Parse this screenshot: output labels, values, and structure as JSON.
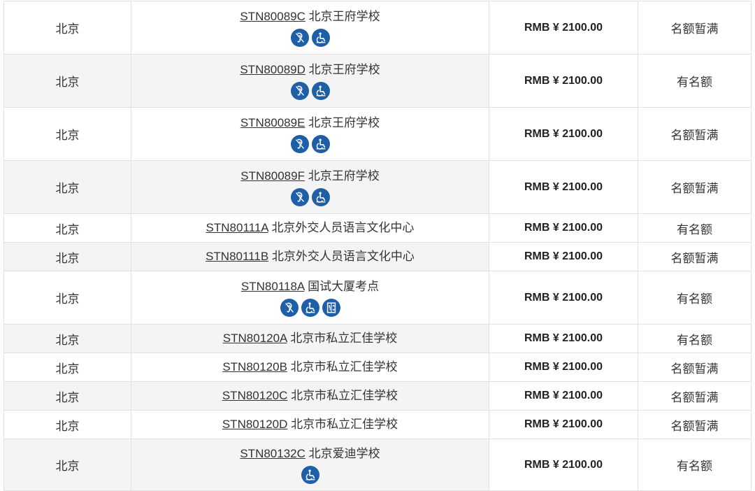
{
  "rows": [
    {
      "city": "北京",
      "code": "STN80089C",
      "name": "北京王府学校",
      "icons": [
        "hearing-icon",
        "wheelchair-icon"
      ],
      "price": "RMB ¥ 2100.00",
      "status": "名额暂满"
    },
    {
      "city": "北京",
      "code": "STN80089D",
      "name": "北京王府学校",
      "icons": [
        "hearing-icon",
        "wheelchair-icon"
      ],
      "price": "RMB ¥ 2100.00",
      "status": "有名额"
    },
    {
      "city": "北京",
      "code": "STN80089E",
      "name": "北京王府学校",
      "icons": [
        "hearing-icon",
        "wheelchair-icon"
      ],
      "price": "RMB ¥ 2100.00",
      "status": "名额暂满"
    },
    {
      "city": "北京",
      "code": "STN80089F",
      "name": "北京王府学校",
      "icons": [
        "hearing-icon",
        "wheelchair-icon"
      ],
      "price": "RMB ¥ 2100.00",
      "status": "名额暂满"
    },
    {
      "city": "北京",
      "code": "STN80111A",
      "name": "北京外交人员语言文化中心",
      "icons": [],
      "price": "RMB ¥ 2100.00",
      "status": "有名额"
    },
    {
      "city": "北京",
      "code": "STN80111B",
      "name": "北京外交人员语言文化中心",
      "icons": [],
      "price": "RMB ¥ 2100.00",
      "status": "名额暂满"
    },
    {
      "city": "北京",
      "code": "STN80118A",
      "name": "国试大厦考点",
      "icons": [
        "hearing-icon",
        "wheelchair-icon",
        "elevator-icon"
      ],
      "price": "RMB ¥ 2100.00",
      "status": "有名额"
    },
    {
      "city": "北京",
      "code": "STN80120A",
      "name": "北京市私立汇佳学校",
      "icons": [],
      "price": "RMB ¥ 2100.00",
      "status": "有名额"
    },
    {
      "city": "北京",
      "code": "STN80120B",
      "name": "北京市私立汇佳学校",
      "icons": [],
      "price": "RMB ¥ 2100.00",
      "status": "名额暂满"
    },
    {
      "city": "北京",
      "code": "STN80120C",
      "name": "北京市私立汇佳学校",
      "icons": [],
      "price": "RMB ¥ 2100.00",
      "status": "名额暂满"
    },
    {
      "city": "北京",
      "code": "STN80120D",
      "name": "北京市私立汇佳学校",
      "icons": [],
      "price": "RMB ¥ 2100.00",
      "status": "名额暂满"
    },
    {
      "city": "北京",
      "code": "STN80132C",
      "name": "北京爱迪学校",
      "icons": [
        "wheelchair-icon"
      ],
      "price": "RMB ¥ 2100.00",
      "status": "有名额"
    }
  ],
  "colors": {
    "icon_bg": "#1f5fa8",
    "border": "#e1e1e1",
    "zebra": "#f4f4f4"
  }
}
